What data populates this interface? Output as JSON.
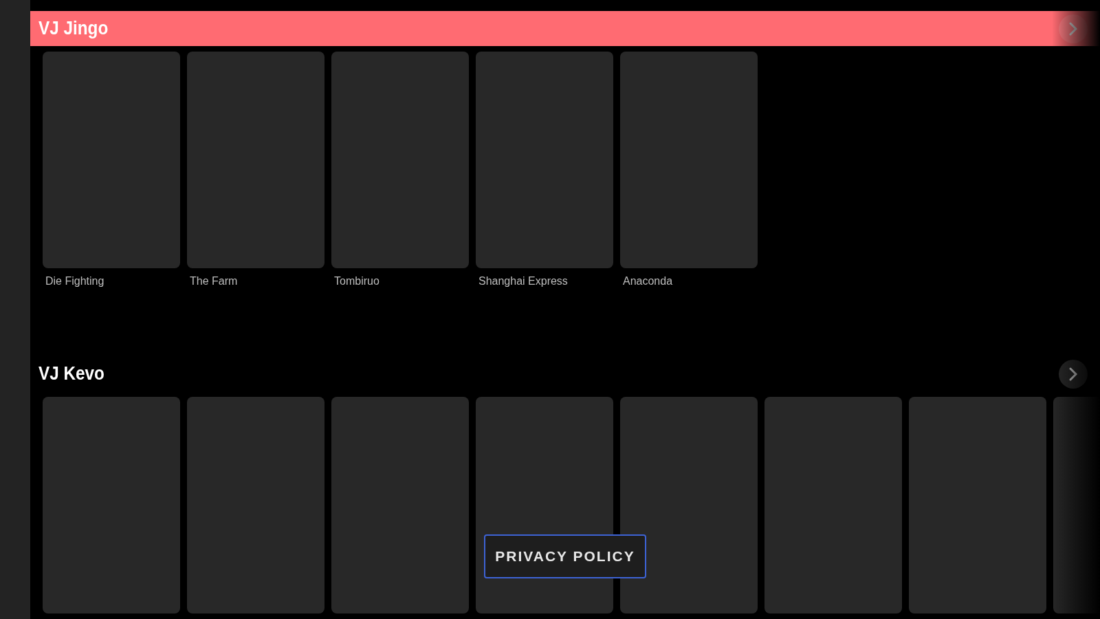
{
  "sections": [
    {
      "title": "VJ Jingo",
      "selected": true,
      "items": [
        {
          "kind": "poster",
          "caption": "Die Fighting"
        },
        {
          "kind": "poster",
          "caption": "The Farm"
        },
        {
          "kind": "poster",
          "caption": "Tombiruo"
        },
        {
          "kind": "poster",
          "caption": "Shanghai Express"
        },
        {
          "kind": "poster",
          "caption": "Anaconda"
        }
      ]
    },
    {
      "title": "VJ Kevo",
      "selected": false,
      "items": [
        {
          "kind": "poster"
        },
        {
          "kind": "poster"
        },
        {
          "kind": "poster"
        },
        {
          "kind": "poster"
        },
        {
          "kind": "poster"
        },
        {
          "kind": "poster"
        },
        {
          "kind": "poster"
        },
        {
          "kind": "poster"
        }
      ]
    }
  ],
  "privacy_button": {
    "label": "PRIVACY POLICY",
    "focused": true
  }
}
